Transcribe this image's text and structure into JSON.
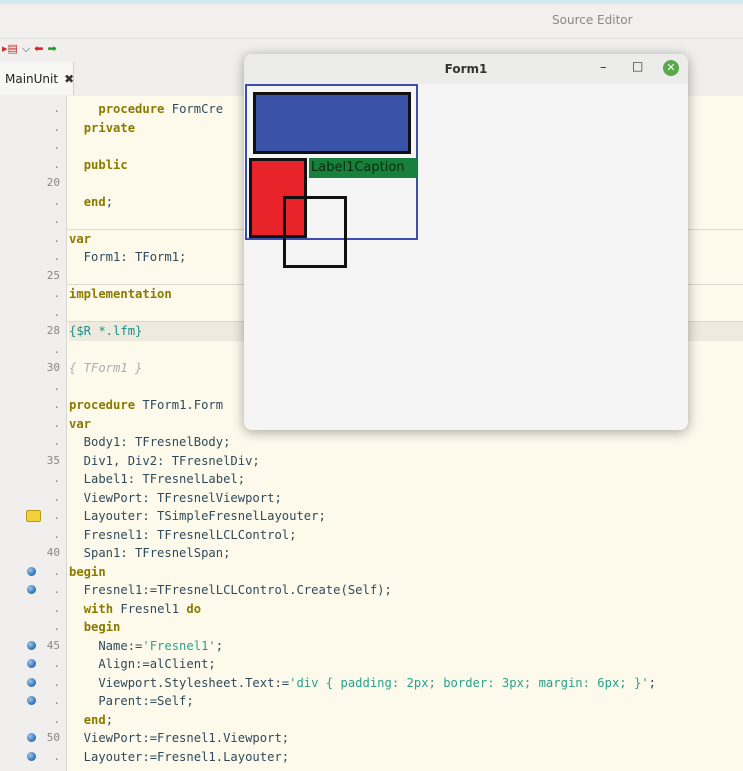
{
  "editor": {
    "title": "Source Editor",
    "tab": {
      "label": "MainUnit",
      "close": "✖"
    },
    "toolbar": {
      "jump_icon": "▸▤",
      "dropdown": "⌵",
      "back_arrow": "⬅",
      "forward_arrow": "➡"
    }
  },
  "gutter": [
    {
      "ln": "."
    },
    {
      "ln": "."
    },
    {
      "ln": "."
    },
    {
      "ln": "."
    },
    {
      "ln": "20"
    },
    {
      "ln": "."
    },
    {
      "ln": "."
    },
    {
      "ln": "."
    },
    {
      "ln": "."
    },
    {
      "ln": "25"
    },
    {
      "ln": "."
    },
    {
      "ln": "."
    },
    {
      "ln": "28"
    },
    {
      "ln": "."
    },
    {
      "ln": "30"
    },
    {
      "ln": "."
    },
    {
      "ln": "."
    },
    {
      "ln": "."
    },
    {
      "ln": "."
    },
    {
      "ln": "35"
    },
    {
      "ln": "."
    },
    {
      "ln": "."
    },
    {
      "ln": ".",
      "bookmark": true
    },
    {
      "ln": "."
    },
    {
      "ln": "40"
    },
    {
      "ln": ".",
      "bp": true
    },
    {
      "ln": ".",
      "bp": true
    },
    {
      "ln": "."
    },
    {
      "ln": "."
    },
    {
      "ln": "45",
      "bp": true
    },
    {
      "ln": ".",
      "bp": true
    },
    {
      "ln": ".",
      "bp": true
    },
    {
      "ln": ".",
      "bp": true
    },
    {
      "ln": "."
    },
    {
      "ln": "50",
      "bp": true
    },
    {
      "ln": ".",
      "bp": true
    }
  ],
  "code": [
    [
      {
        "t": "    "
      },
      {
        "t": "procedure",
        "c": "kw"
      },
      {
        "t": " FormCre"
      }
    ],
    [
      {
        "t": "  "
      },
      {
        "t": "private",
        "c": "kw"
      }
    ],
    [
      {
        "t": ""
      }
    ],
    [
      {
        "t": "  "
      },
      {
        "t": "public",
        "c": "kw"
      }
    ],
    [
      {
        "t": ""
      }
    ],
    [
      {
        "t": "  "
      },
      {
        "t": "end",
        "c": "kw"
      },
      {
        "t": ";"
      }
    ],
    [
      {
        "t": ""
      }
    ],
    [
      {
        "t": "var",
        "c": "kw"
      }
    ],
    [
      {
        "t": "  Form1: TForm1;"
      }
    ],
    [
      {
        "t": ""
      }
    ],
    [
      {
        "t": "implementation",
        "c": "kw"
      }
    ],
    [
      {
        "t": ""
      }
    ],
    [
      {
        "t": "{$R *.lfm}",
        "c": "dir"
      }
    ],
    [
      {
        "t": ""
      }
    ],
    [
      {
        "t": "{ TForm1 }",
        "c": "cmt"
      }
    ],
    [
      {
        "t": ""
      }
    ],
    [
      {
        "t": "procedure",
        "c": "kw"
      },
      {
        "t": " TForm1.Form"
      }
    ],
    [
      {
        "t": "var",
        "c": "kw"
      }
    ],
    [
      {
        "t": "  Body1: TFresnelBody;"
      }
    ],
    [
      {
        "t": "  Div1, Div2: TFresnelDiv;"
      }
    ],
    [
      {
        "t": "  Label1: TFresnelLabel;"
      }
    ],
    [
      {
        "t": "  ViewPort: TFresnelViewport;"
      }
    ],
    [
      {
        "t": "  Layouter: TSimpleFresnelLayouter;"
      }
    ],
    [
      {
        "t": "  Fresnel1: TFresnelLCLControl;"
      }
    ],
    [
      {
        "t": "  Span1: TFresnelSpan;"
      }
    ],
    [
      {
        "t": "begin",
        "c": "kw"
      }
    ],
    [
      {
        "t": "  Fresnel1:=TFresnelLCLControl.Create(Self);"
      }
    ],
    [
      {
        "t": "  "
      },
      {
        "t": "with",
        "c": "kw"
      },
      {
        "t": " Fresnel1 "
      },
      {
        "t": "do",
        "c": "kw"
      }
    ],
    [
      {
        "t": "  "
      },
      {
        "t": "begin",
        "c": "kw"
      }
    ],
    [
      {
        "t": "    Name:="
      },
      {
        "t": "'Fresnel1'",
        "c": "str"
      },
      {
        "t": ";"
      }
    ],
    [
      {
        "t": "    Align:=alClient;"
      }
    ],
    [
      {
        "t": "    Viewport.Stylesheet.Text:="
      },
      {
        "t": "'div { padding: 2px; border: 3px; margin: 6px; }'",
        "c": "str"
      },
      {
        "t": ";"
      }
    ],
    [
      {
        "t": "    Parent:=Self;"
      }
    ],
    [
      {
        "t": "  "
      },
      {
        "t": "end",
        "c": "kw"
      },
      {
        "t": ";"
      }
    ],
    [
      {
        "t": "  ViewPort:=Fresnel1.Viewport;"
      }
    ],
    [
      {
        "t": "  Layouter:=Fresnel1.Layouter;"
      }
    ]
  ],
  "form": {
    "title": "Form1",
    "minimize": "–",
    "maximize": "□",
    "close": "✕",
    "label_caption": "Label1Caption"
  },
  "colors": {
    "div_blue": "#3a53a8",
    "div_red": "#e8232a",
    "label_bg": "#17803a",
    "fresnel_border": "#3b4dae",
    "keyword": "#8a7a00",
    "string": "#28a18d"
  }
}
